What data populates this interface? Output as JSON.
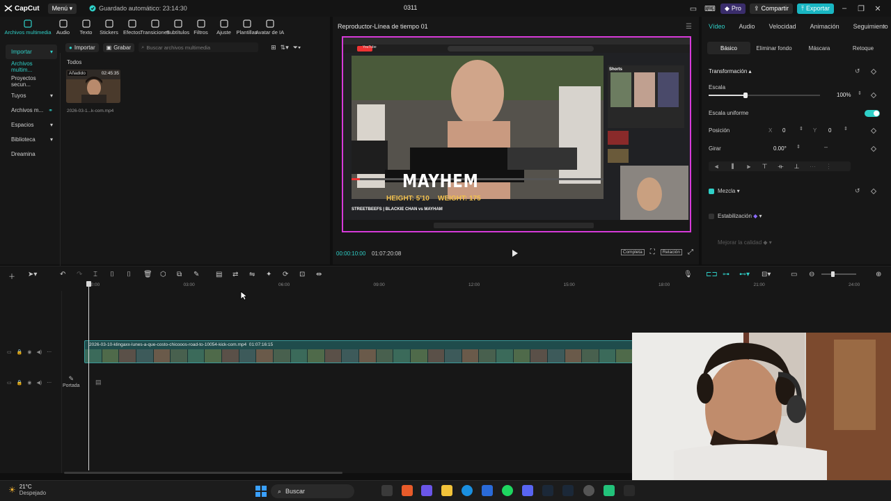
{
  "titlebar": {
    "app_name": "CapCut",
    "menu_label": "Menú",
    "save_status": "Guardado automático: 23:14:30",
    "project_title": "0311",
    "pro_label": "Pro",
    "share_label": "Compartir",
    "export_label": "Exportar"
  },
  "tool_tabs": [
    {
      "label": "Archivos multimedia",
      "icon": "media-icon"
    },
    {
      "label": "Audio",
      "icon": "audio-icon"
    },
    {
      "label": "Texto",
      "icon": "text-icon"
    },
    {
      "label": "Stickers",
      "icon": "sticker-icon"
    },
    {
      "label": "Efectos",
      "icon": "effects-icon"
    },
    {
      "label": "Transiciones",
      "icon": "transitions-icon"
    },
    {
      "label": "Subtítulos",
      "icon": "subtitles-icon"
    },
    {
      "label": "Filtros",
      "icon": "filters-icon"
    },
    {
      "label": "Ajuste",
      "icon": "adjust-icon"
    },
    {
      "label": "Plantillas",
      "icon": "templates-icon"
    },
    {
      "label": "Avatar de IA",
      "icon": "ai-avatar-icon"
    }
  ],
  "sidebar": {
    "items": [
      {
        "label": "Importar"
      },
      {
        "label": "Archivos multim..."
      },
      {
        "label": "Proyectos secun..."
      },
      {
        "label": "Tuyos"
      },
      {
        "label": "Archivos m..."
      },
      {
        "label": "Espacios"
      },
      {
        "label": "Biblioteca"
      },
      {
        "label": "Dreamina"
      }
    ]
  },
  "media": {
    "import_label": "Importar",
    "record_label": "Grabar",
    "search_placeholder": "Buscar archivos multimedia",
    "filter_all": "Todos",
    "clip_tag": "Añadido",
    "clip_duration": "02:45:35",
    "clip_name": "2026-03-1...k-com.mp4"
  },
  "player": {
    "title": "Reproductor-Línea de tiempo 01",
    "current_time": "00:00:10:00",
    "total_time": "01:07:20:08",
    "full_label": "Completa",
    "ratio_label": "Relación",
    "overlay_text": "MAYHEM",
    "overlay_height": "HEIGHT: 5'10",
    "overlay_weight": "WEIGHT: 175",
    "overlay_caption": "STREETBEEFS | BLACKIE CHAN vs MAYHAM",
    "yt_sidebar_shorts": "Shorts",
    "yt_logo": "YouTube"
  },
  "inspector": {
    "tabs": [
      "Vídeo",
      "Audio",
      "Velocidad",
      "Animación",
      "Seguimiento"
    ],
    "sub_tabs": [
      "Básico",
      "Eliminar fondo",
      "Máscara",
      "Retoque"
    ],
    "section_transform": "Transformación",
    "scale_label": "Escala",
    "scale_value": "100%",
    "uniform_label": "Escala uniforme",
    "position_label": "Posición",
    "pos_x_label": "X",
    "pos_x": "0",
    "pos_y_label": "Y",
    "pos_y": "0",
    "rotate_label": "Girar",
    "rotate_value": "0.00°",
    "blend_label": "Mezcla",
    "stabilize_label": "Estabilización",
    "enhance_label": "Mejorar la calidad",
    "scale_level": 0.33
  },
  "timeline": {
    "ticks": [
      "00:00",
      "03:00",
      "06:00",
      "09:00",
      "12:00",
      "15:00",
      "18:00",
      "21:00",
      "24:00"
    ],
    "clip_name": "2026-03-10-klingaxx-lunes-a-que-costo-chicooos-road-to-10054-kick-com.mp4",
    "clip_duration": "01:07:16:15",
    "cover_label": "Portada"
  },
  "taskbar": {
    "temperature": "21°C",
    "weather": "Despejado",
    "search_label": "Buscar"
  },
  "colors": {
    "accent": "#2fd0c8",
    "player_border": "#d63ad9",
    "export_bg": "#19b6c2",
    "pro_bg": "#3a2d6b"
  }
}
